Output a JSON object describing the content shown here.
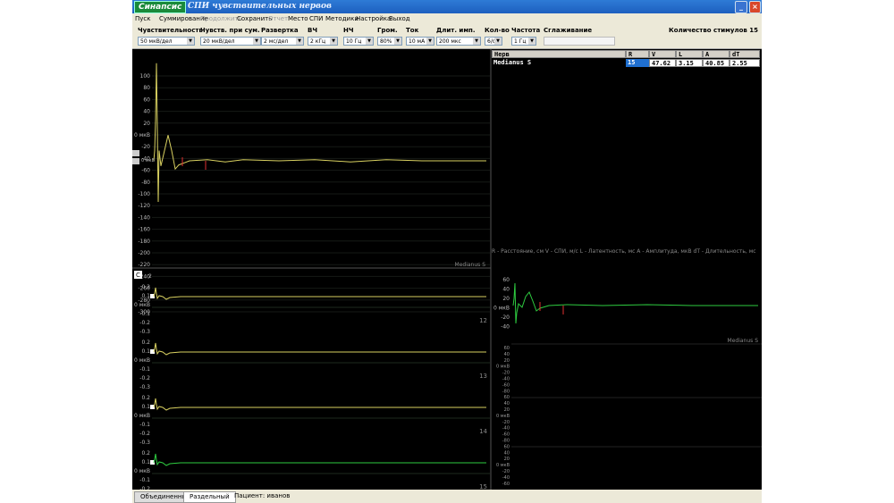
{
  "window": {
    "logo": "Синапсис",
    "title": "СПИ чувствительных нервов"
  },
  "menu": [
    {
      "label": "Пуск",
      "disabled": false
    },
    {
      "label": "Суммирование",
      "disabled": false
    },
    {
      "label": "Продолжить",
      "disabled": true
    },
    {
      "label": "Сохранить",
      "disabled": false
    },
    {
      "label": "Отчет",
      "disabled": true
    },
    {
      "label": "Место",
      "disabled": false
    },
    {
      "label": "СПИ",
      "disabled": false
    },
    {
      "label": "Методики",
      "disabled": false
    },
    {
      "label": "Настройка",
      "disabled": false
    },
    {
      "label": "Выход",
      "disabled": false
    }
  ],
  "params": [
    {
      "label": "Чувствительность",
      "value": "50 мкВ/дел"
    },
    {
      "label": "Чувств. при сум.",
      "value": "20 мкВ/дел"
    },
    {
      "label": "Развертка",
      "value": "2 мс/дел"
    },
    {
      "label": "ВЧ",
      "value": "2 кГц"
    },
    {
      "label": "НЧ",
      "value": "10 Гц"
    },
    {
      "label": "Гром.",
      "value": "80%"
    },
    {
      "label": "Ток",
      "value": "10 мА"
    },
    {
      "label": "Длит. имп.",
      "value": "200 мкс"
    },
    {
      "label": "Кол-во",
      "value": "6/о"
    },
    {
      "label": "Частота",
      "value": "1 Гц"
    },
    {
      "label": "Сглаживание",
      "value": ""
    }
  ],
  "stimuli_count": "Количество стимулов 15",
  "main_plot": {
    "y_ticks": [
      "100",
      "80",
      "60",
      "40",
      "20",
      "0 мкВ",
      "-20",
      "-40",
      "-60",
      "-80",
      "-100",
      "-120",
      "-140",
      "-160",
      "-180",
      "-200",
      "-220",
      "-240",
      "-260",
      "-280",
      "-300"
    ],
    "trace_label": "Medianus S"
  },
  "table": {
    "headers": [
      "Нерв",
      "R",
      "V",
      "L",
      "A",
      "dT"
    ],
    "row": [
      "Medianus S",
      "15",
      "47.62",
      "3.15",
      "40.85",
      "2.55"
    ]
  },
  "legend": "R - Расстояние, см   V - СПИ, м/с   L - Латентность, мс   A - Амплитуда, мкВ   dT - Длительность, мс",
  "small_plots": [
    {
      "number": "12",
      "ticks_top": [
        "0.2",
        "0.1",
        "0 мкВ",
        "-0.1",
        "-0.2",
        "-0.3"
      ],
      "color": "#d8d060"
    },
    {
      "number": "13",
      "ticks_top": [
        "0.2",
        "0.1",
        "0 мкВ",
        "-0.1",
        "-0.2",
        "-0.3"
      ],
      "color": "#d8d060"
    },
    {
      "number": "14",
      "ticks_top": [
        "0.2",
        "0.1",
        "0 мкВ",
        "-0.1",
        "-0.2",
        "-0.3"
      ],
      "color": "#d8d060"
    },
    {
      "number": "15",
      "ticks_top": [
        "0.2",
        "0.1",
        "0 мкВ",
        "-0.1",
        "-0.2",
        "-0.3"
      ],
      "color": "#2ecc40"
    }
  ],
  "small_first_tick": "2",
  "small_label_c": "C",
  "right_plot": {
    "ticks_upper": [
      "60",
      "40",
      "20",
      "0 мкВ",
      "-20",
      "-40"
    ],
    "label": "Medianus S",
    "ticks_lower": [
      "60",
      "40",
      "20",
      "0 мкВ",
      "-20",
      "-40",
      "-60",
      "-80",
      "60",
      "40",
      "20",
      "0 мкВ",
      "-20",
      "-40",
      "-60",
      "-80",
      "60",
      "40",
      "20",
      "0 мкВ",
      "-20",
      "-40",
      "-60"
    ]
  },
  "tabs": {
    "merged": "Объединенный",
    "split": "Раздельный",
    "patient": "Пациент: иванов"
  },
  "colors": {
    "trace_yellow": "#d8d060",
    "trace_green": "#2ecc40",
    "marker_red": "#e03030",
    "grid": "#1e2a1e"
  }
}
